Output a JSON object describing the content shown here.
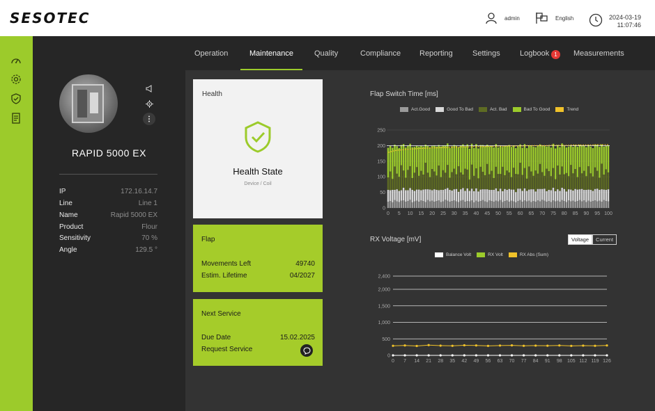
{
  "header": {
    "logo": "SESOTEC",
    "user": "admin",
    "language": "English",
    "date": "2024-03-19",
    "time": "11:07:46"
  },
  "rail": {
    "icons": [
      "dashboard-icon",
      "settings-gear-icon",
      "shield-icon",
      "report-icon"
    ]
  },
  "device": {
    "title": "RAPID 5000 EX",
    "icons": [
      "megaphone-icon",
      "locate-icon",
      "more-vertical-icon"
    ],
    "props": [
      {
        "key": "IP",
        "value": "172.16.14.7"
      },
      {
        "key": "Line",
        "value": "Line 1"
      },
      {
        "key": "Name",
        "value": "Rapid 5000 EX"
      },
      {
        "key": "Product",
        "value": "Flour"
      },
      {
        "key": "Sensitivity",
        "value": "70 %"
      },
      {
        "key": "Angle",
        "value": "129.5 °"
      }
    ]
  },
  "tabs": {
    "items": [
      "Operation",
      "Maintenance",
      "Quality",
      "Compliance",
      "Reporting",
      "Settings",
      "Logbook",
      "Measurements"
    ],
    "active": "Maintenance",
    "logbook_badge": "1"
  },
  "health": {
    "title": "Health",
    "state": "Health State",
    "sub": "Device / Coil"
  },
  "flap": {
    "title": "Flap",
    "movements_label": "Movements Left",
    "movements_value": "49740",
    "lifetime_label": "Estim. Lifetime",
    "lifetime_value": "04/2027"
  },
  "service": {
    "title": "Next Service",
    "due_label": "Due Date",
    "due_value": "15.02.2025",
    "request_label": "Request Service"
  },
  "colors": {
    "accent": "#9ccb2b",
    "good": "#9a9a9a",
    "good_to_bad": "#d8d8d8",
    "bad": "#5e6b23",
    "bad_to_good": "#9ccb2b",
    "trend": "#f0c22a"
  },
  "chart_data": [
    {
      "type": "bar",
      "title": "Flap Switch Time [ms]",
      "legend": [
        "Act.Good",
        "Good To Bad",
        "Act. Bad",
        "Bad To Good",
        "Trend"
      ],
      "ylim": [
        0,
        250
      ],
      "yticks": [
        0,
        50,
        100,
        150,
        200,
        250
      ],
      "xticks": [
        0,
        5,
        10,
        15,
        20,
        25,
        30,
        35,
        40,
        45,
        50,
        55,
        60,
        65,
        70,
        75,
        80,
        85,
        90,
        95,
        100
      ],
      "x_count": 101,
      "series": [
        {
          "name": "Act.Good",
          "values": [
            20,
            22,
            18,
            25,
            21,
            19,
            23,
            24,
            20,
            22,
            26,
            18,
            21,
            23,
            20,
            24,
            22,
            19,
            25,
            21,
            23,
            20,
            22,
            24,
            19,
            21,
            26,
            23,
            20,
            22,
            24,
            21,
            19,
            23,
            25,
            20,
            22,
            21,
            24,
            18,
            23,
            20,
            22,
            25,
            21,
            19,
            24,
            22,
            20,
            23,
            21,
            25,
            19,
            22,
            24,
            20,
            23,
            21,
            18,
            22,
            25,
            20,
            24,
            21,
            23,
            19,
            22,
            20,
            24,
            21,
            26,
            23,
            20,
            22,
            19,
            24,
            21,
            23,
            20,
            25,
            22,
            19,
            24,
            21,
            23,
            20,
            22,
            25,
            21,
            24,
            19,
            23,
            20,
            22,
            24,
            21,
            23,
            20,
            25,
            22,
            21
          ]
        },
        {
          "name": "Good To Bad",
          "values": [
            38,
            35,
            40,
            33,
            39,
            36,
            34,
            41,
            37,
            35,
            38,
            40,
            34,
            36,
            39,
            33,
            37,
            41,
            35,
            38,
            34,
            40,
            36,
            33,
            39,
            37,
            35,
            41,
            38,
            34,
            36,
            40,
            33,
            37,
            39,
            35,
            41,
            34,
            38,
            36,
            40,
            33,
            37,
            35,
            39,
            41,
            34,
            36,
            38,
            40,
            33,
            37,
            35,
            39,
            34,
            41,
            36,
            38,
            33,
            40,
            37,
            35,
            39,
            34,
            36,
            41,
            38,
            33,
            37,
            40,
            35,
            39,
            34,
            36,
            38,
            41,
            33,
            37,
            35,
            40,
            39,
            34,
            36,
            38,
            33,
            41,
            37,
            35,
            40,
            34,
            39,
            36,
            38,
            33,
            37,
            41,
            35,
            40,
            34,
            36,
            39
          ]
        },
        {
          "name": "Act. Bad",
          "values": [
            40,
            60,
            35,
            75,
            50,
            45,
            80,
            55,
            40,
            65,
            70,
            38,
            58,
            72,
            44,
            62,
            48,
            85,
            53,
            40,
            68,
            57,
            46,
            79,
            41,
            63,
            52,
            74,
            39,
            59,
            66,
            47,
            82,
            54,
            43,
            71,
            60,
            36,
            77,
            49,
            64,
            42,
            73,
            56,
            45,
            81,
            50,
            61,
            38,
            69,
            55,
            47,
            78,
            44,
            62,
            53,
            40,
            70,
            58,
            46,
            83,
            51,
            65,
            39,
            74,
            57,
            43,
            67,
            49,
            80,
            54,
            41,
            72,
            60,
            45,
            63,
            38,
            76,
            52,
            68,
            47,
            59,
            42,
            79,
            55,
            64,
            40,
            71,
            50,
            61,
            44,
            75,
            53,
            46,
            69,
            57,
            39,
            82,
            48,
            66,
            54
          ]
        },
        {
          "name": "Bad To Good",
          "values": [
            95,
            82,
            100,
            70,
            88,
            92,
            65,
            85,
            97,
            78,
            72,
            99,
            83,
            68,
            94,
            80,
            90,
            58,
            86,
            96,
            74,
            84,
            93,
            66,
            98,
            79,
            88,
            69,
            95,
            83,
            76,
            91,
            60,
            87,
            97,
            72,
            81,
            99,
            67,
            89,
            78,
            96,
            70,
            86,
            93,
            62,
            90,
            80,
            98,
            73,
            85,
            92,
            64,
            94,
            79,
            88,
            97,
            71,
            83,
            90,
            59,
            87,
            77,
            98,
            68,
            84,
            94,
            75,
            89,
            63,
            86,
            96,
            71,
            80,
            92,
            78,
            99,
            66,
            88,
            74,
            91,
            82,
            95,
            61,
            85,
            77,
            97,
            72,
            89,
            80,
            93,
            68,
            86,
            91,
            74,
            84,
            99,
            62,
            90,
            75,
            87
          ]
        }
      ],
      "trend": [
        178,
        180,
        182,
        184,
        185,
        186,
        186,
        187,
        188,
        188,
        189,
        189,
        190,
        190,
        191,
        191,
        191,
        192,
        192,
        192,
        193,
        193,
        193,
        193,
        194,
        194,
        194,
        194,
        195,
        195,
        195,
        195,
        195,
        196,
        196,
        196,
        196,
        196,
        196,
        197,
        197,
        197,
        197,
        197,
        197,
        197,
        198,
        198,
        198,
        198,
        198,
        198,
        198,
        198,
        199,
        199,
        199,
        199,
        199,
        199,
        199,
        199,
        199,
        200,
        200,
        200,
        200,
        200,
        200,
        200,
        200,
        200,
        200,
        201,
        201,
        201,
        201,
        201,
        201,
        201,
        201,
        201,
        201,
        202,
        202,
        202,
        202,
        202,
        202,
        202,
        202,
        202,
        202,
        202,
        203,
        203,
        203,
        203,
        203,
        203,
        203
      ]
    },
    {
      "type": "line",
      "title": "RX Voltage [mV]",
      "legend": [
        "Balance Volt",
        "RX Volt",
        "RX Abs (Sum)"
      ],
      "toggle": [
        "Voltage",
        "Current"
      ],
      "toggle_active": "Voltage",
      "ylim": [
        0,
        2400
      ],
      "yticks": [
        0,
        500,
        1000,
        1500,
        2000,
        2400
      ],
      "ytick_labels": [
        "0",
        "500",
        "1,000",
        "1,500",
        "2,000",
        "2,400"
      ],
      "xticks": [
        0,
        7,
        14,
        21,
        28,
        35,
        42,
        49,
        56,
        63,
        70,
        77,
        84,
        91,
        98,
        105,
        112,
        119,
        126
      ],
      "series": [
        {
          "name": "Balance Volt",
          "values": [
            0,
            0,
            0,
            0,
            0,
            0,
            0,
            0,
            0,
            0,
            0,
            0,
            0,
            0,
            0,
            0,
            0,
            0,
            0
          ]
        },
        {
          "name": "RX Volt",
          "values": [
            0,
            0,
            0,
            0,
            0,
            0,
            0,
            0,
            0,
            0,
            0,
            0,
            0,
            0,
            0,
            0,
            0,
            0,
            0
          ]
        },
        {
          "name": "RX Abs (Sum)",
          "values": [
            290,
            300,
            285,
            310,
            295,
            290,
            305,
            300,
            288,
            298,
            302,
            290,
            296,
            292,
            300,
            288,
            295,
            290,
            300
          ]
        }
      ]
    }
  ]
}
